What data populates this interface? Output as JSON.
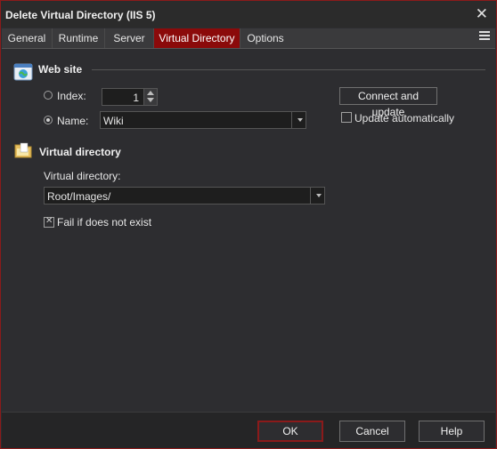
{
  "window": {
    "title": "Delete Virtual Directory (IIS 5)",
    "close_glyph": "✕"
  },
  "tabs": [
    {
      "label": "General"
    },
    {
      "label": "Runtime"
    },
    {
      "label": "Server"
    },
    {
      "label": "Virtual Directory",
      "active": true
    },
    {
      "label": "Options"
    }
  ],
  "website": {
    "section_title": "Web site",
    "index_label": "Index:",
    "index_value": "1",
    "name_label": "Name:",
    "name_value": "Wiki",
    "selected_option": "Name",
    "connect_button": "Connect and update",
    "auto_update_label": "Update automatically",
    "auto_update_checked": false
  },
  "virtual": {
    "section_title": "Virtual directory",
    "field_label": "Virtual directory:",
    "field_value": "Root/Images/",
    "fail_label": "Fail if does not exist",
    "fail_checked": true
  },
  "footer": {
    "ok": "OK",
    "cancel": "Cancel",
    "help": "Help"
  },
  "colors": {
    "accent": "#8b0a0a",
    "background": "#2d2d30",
    "text": "#e6e6e6"
  },
  "icons": {
    "website_section": "website-globe-icon",
    "virtual_section": "folder-icon",
    "tab_menu": "hamburger-icon"
  }
}
